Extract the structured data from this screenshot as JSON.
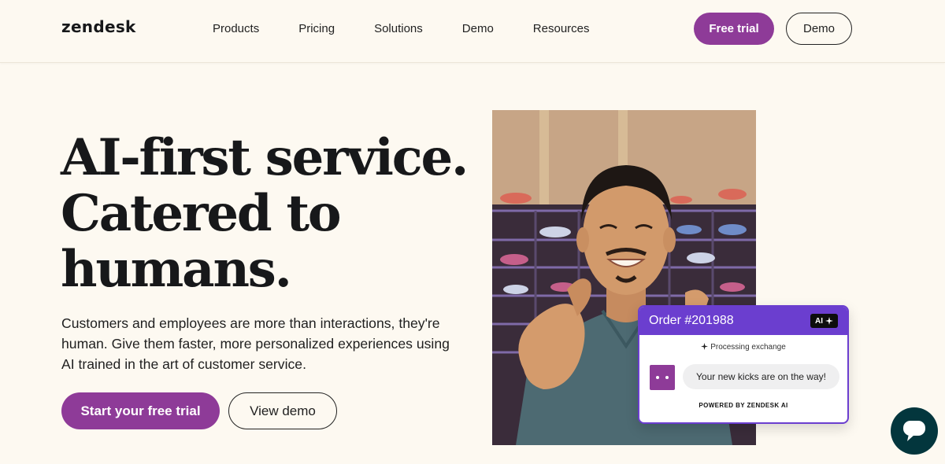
{
  "header": {
    "logo": "zendesk",
    "nav": [
      "Products",
      "Pricing",
      "Solutions",
      "Demo",
      "Resources"
    ],
    "free_trial": "Free trial",
    "demo": "Demo"
  },
  "hero": {
    "title_lines": [
      "AI-first service.",
      "Catered to",
      "humans."
    ],
    "subtitle": "Customers and employees are more than interactions, they're human. Give them faster, more personalized experiences using AI trained in the art of customer service.",
    "cta_primary": "Start your free trial",
    "cta_secondary": "View demo"
  },
  "order_card": {
    "title": "Order #201988",
    "badge": "AI",
    "badge_icon": "sparkle-icon",
    "status": "Processing exchange",
    "message": "Your new kicks are on the way!",
    "footer": "POWERED BY ZENDESK AI"
  },
  "chat_launcher": {
    "icon": "chat-bubble-icon"
  },
  "colors": {
    "background": "#fdf9f1",
    "brand_purple": "#8e3b98",
    "card_accent": "#6b3ecf",
    "chat_teal": "#03363d"
  }
}
